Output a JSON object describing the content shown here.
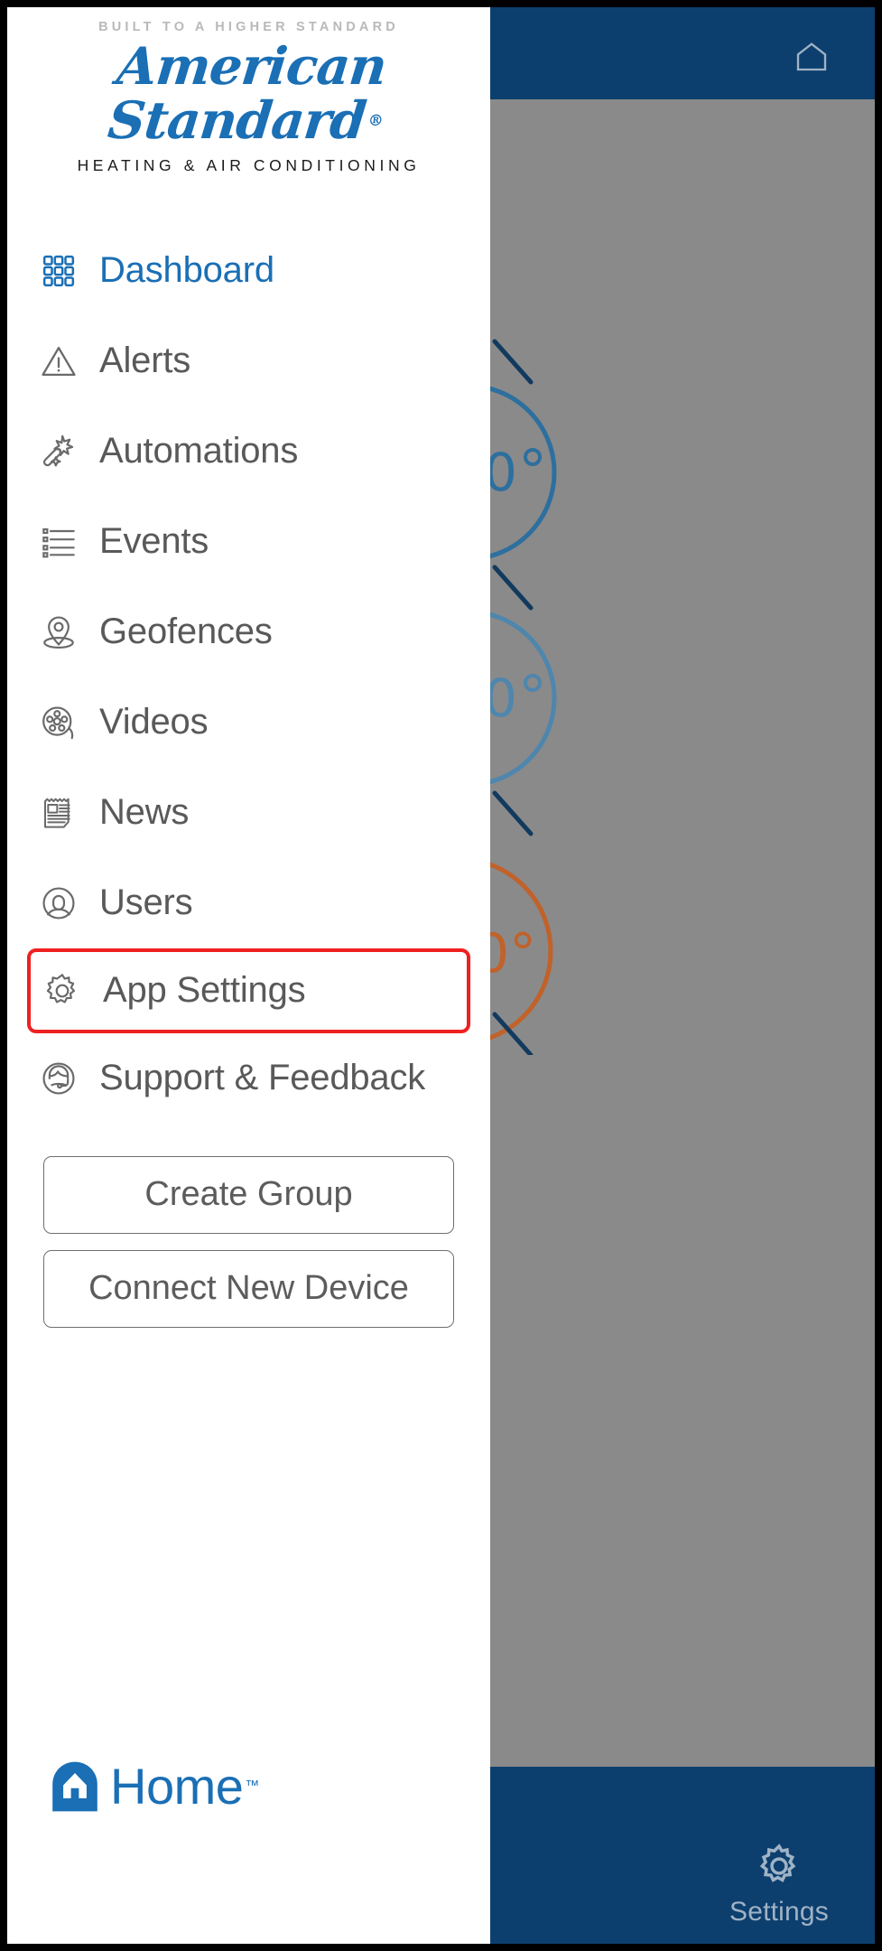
{
  "brand": {
    "tagline": "BUILT TO A HIGHER STANDARD",
    "wordmark": "American Standard",
    "registered": "®",
    "subline": "HEATING & AIR CONDITIONING"
  },
  "colors": {
    "accent_blue": "#1a6fb5",
    "navy": "#0d3f6e",
    "highlight_red": "#ef2020",
    "nav_text": "#595959",
    "backdrop_gray": "#8a8a8a"
  },
  "nav": {
    "items": [
      {
        "label": "Dashboard",
        "icon": "grid-icon",
        "active": true,
        "highlighted": false
      },
      {
        "label": "Alerts",
        "icon": "warning-triangle-icon",
        "active": false,
        "highlighted": false
      },
      {
        "label": "Automations",
        "icon": "magic-wand-icon",
        "active": false,
        "highlighted": false
      },
      {
        "label": "Events",
        "icon": "list-icon",
        "active": false,
        "highlighted": false
      },
      {
        "label": "Geofences",
        "icon": "map-pin-icon",
        "active": false,
        "highlighted": false
      },
      {
        "label": "Videos",
        "icon": "film-reel-icon",
        "active": false,
        "highlighted": false
      },
      {
        "label": "News",
        "icon": "newspaper-icon",
        "active": false,
        "highlighted": false
      },
      {
        "label": "Users",
        "icon": "user-circle-icon",
        "active": false,
        "highlighted": false
      },
      {
        "label": "App Settings",
        "icon": "gear-icon",
        "active": false,
        "highlighted": true
      },
      {
        "label": "Support & Feedback",
        "icon": "headset-icon",
        "active": false,
        "highlighted": false
      }
    ]
  },
  "actions": {
    "create_group": "Create Group",
    "connect_device": "Connect New Device"
  },
  "footer": {
    "home_label": "Home",
    "trademark": "™"
  },
  "background": {
    "top_bar_icon": "home-outline-icon",
    "bottom_tab": {
      "label": "Settings",
      "icon": "gear-icon"
    }
  }
}
